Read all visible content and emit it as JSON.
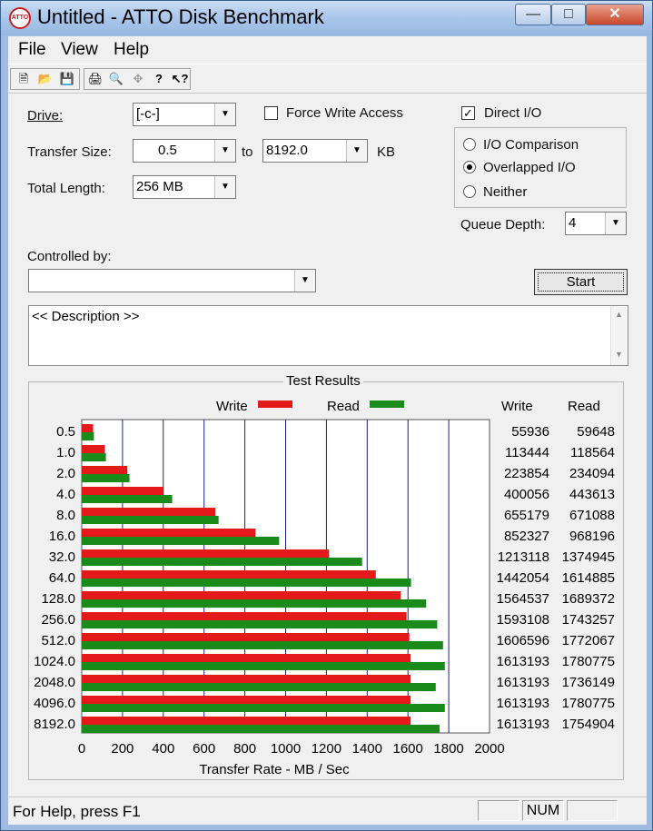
{
  "window": {
    "title": "Untitled - ATTO Disk Benchmark",
    "icon_text": "ATTO"
  },
  "menu": {
    "items": [
      "File",
      "View",
      "Help"
    ]
  },
  "toolbar": {
    "buttons": [
      "new-icon",
      "open-icon",
      "save-icon",
      "print-icon",
      "print-preview-icon",
      "move-icon",
      "help-icon",
      "context-help-icon"
    ]
  },
  "form": {
    "drive_label": "Drive:",
    "drive_value": "[-c-]",
    "force_write_label": "Force Write Access",
    "force_write_checked": false,
    "direct_io_label": "Direct I/O",
    "direct_io_checked": true,
    "transfer_size_label": "Transfer Size:",
    "transfer_from": "0.5",
    "to_label": "to",
    "transfer_to": "8192.0",
    "kb_label": "KB",
    "total_length_label": "Total Length:",
    "total_length_value": "256 MB",
    "io_comparison_label": "I/O Comparison",
    "overlapped_io_label": "Overlapped I/O",
    "neither_label": "Neither",
    "selected_mode": "Overlapped I/O",
    "queue_depth_label": "Queue Depth:",
    "queue_depth_value": "4",
    "controlled_by_label": "Controlled by:",
    "controlled_by_value": "",
    "start_label": "Start",
    "description": "<< Description >>"
  },
  "results": {
    "title": "Test Results",
    "write_label": "Write",
    "read_label": "Read",
    "col_write": "Write",
    "col_read": "Read"
  },
  "chart_data": {
    "type": "bar",
    "orientation": "horizontal",
    "xlabel": "Transfer Rate - MB / Sec",
    "xlim": [
      0,
      2000
    ],
    "xticks": [
      0,
      200,
      400,
      600,
      800,
      1000,
      1200,
      1400,
      1600,
      1800,
      2000
    ],
    "categories": [
      "0.5",
      "1.0",
      "2.0",
      "4.0",
      "8.0",
      "16.0",
      "32.0",
      "64.0",
      "128.0",
      "256.0",
      "512.0",
      "1024.0",
      "2048.0",
      "4096.0",
      "8192.0"
    ],
    "series": [
      {
        "name": "Write",
        "color": "#e41a1a",
        "values": [
          55.936,
          113.444,
          223.854,
          400.056,
          655.179,
          852.327,
          1213.118,
          1442.054,
          1564.537,
          1593.108,
          1606.596,
          1613.193,
          1613.193,
          1613.193,
          1613.193
        ],
        "table": [
          "55936",
          "113444",
          "223854",
          "400056",
          "655179",
          "852327",
          "1213118",
          "1442054",
          "1564537",
          "1593108",
          "1606596",
          "1613193",
          "1613193",
          "1613193",
          "1613193"
        ]
      },
      {
        "name": "Read",
        "color": "#1a8a1a",
        "values": [
          59.648,
          118.564,
          234.094,
          443.613,
          671.088,
          968.196,
          1374.945,
          1614.885,
          1689.372,
          1743.257,
          1772.067,
          1780.775,
          1736.149,
          1780.775,
          1754.904
        ],
        "table": [
          "59648",
          "118564",
          "234094",
          "443613",
          "671088",
          "968196",
          "1374945",
          "1614885",
          "1689372",
          "1743257",
          "1772067",
          "1780775",
          "1736149",
          "1780775",
          "1754904"
        ]
      }
    ],
    "grid": true,
    "legend": "top"
  },
  "status": {
    "help_text": "For Help, press F1",
    "num_text": "NUM"
  }
}
